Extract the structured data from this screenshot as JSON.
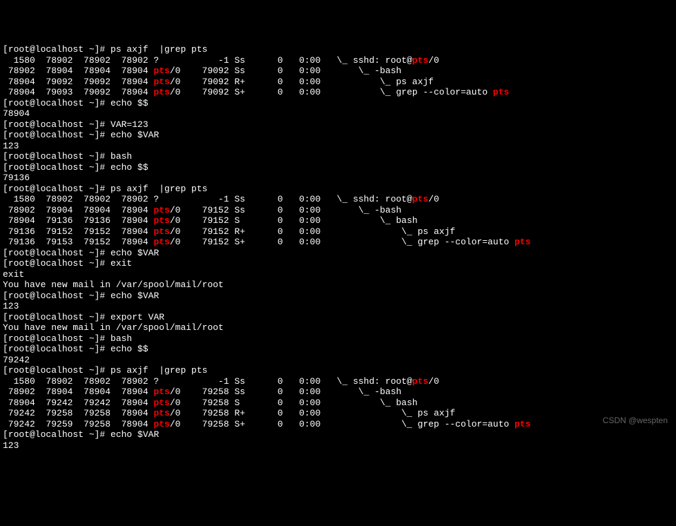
{
  "prompt": "[root@localhost ~]# ",
  "cmd": {
    "ps_grep": "ps axjf  |grep pts",
    "echo_pid": "echo $$",
    "set_var": "VAR=123",
    "echo_var": "echo $VAR",
    "bash": "bash",
    "exit": "exit",
    "export_var": "export VAR"
  },
  "out": {
    "pid_78904": "78904",
    "var_123": "123",
    "pid_79136": "79136",
    "pid_79242": "79242",
    "exit": "exit",
    "blank": "",
    "mail": "You have new mail in /var/spool/mail/root"
  },
  "ps1": {
    "r1": {
      "ppid": "  1580",
      "pid": " 78902",
      "pgid": " 78902",
      "sid": " 78902",
      "tty": "?",
      "tpgid": "   -1",
      "stat": "Ss",
      "uid": "0",
      "time": "0:00",
      "tree": " \\_ sshd: root@",
      "hl": "pts",
      "tail": "/0"
    },
    "r2": {
      "ppid": " 78902",
      "pid": " 78904",
      "pgid": " 78904",
      "sid": " 78904",
      "tty_hl": "pts",
      "tty_tail": "/0",
      "tpgid": "79092",
      "stat": "Ss",
      "uid": "0",
      "time": "0:00",
      "tree": "     \\_ -bash"
    },
    "r3": {
      "ppid": " 78904",
      "pid": " 79092",
      "pgid": " 79092",
      "sid": " 78904",
      "tty_hl": "pts",
      "tty_tail": "/0",
      "tpgid": "79092",
      "stat": "R+",
      "uid": "0",
      "time": "0:00",
      "tree": "         \\_ ps axjf"
    },
    "r4": {
      "ppid": " 78904",
      "pid": " 79093",
      "pgid": " 79092",
      "sid": " 78904",
      "tty_hl": "pts",
      "tty_tail": "/0",
      "tpgid": "79092",
      "stat": "S+",
      "uid": "0",
      "time": "0:00",
      "tree": "         \\_ grep --color=auto ",
      "hl_end": "pts"
    }
  },
  "ps2": {
    "r1": {
      "ppid": "  1580",
      "pid": " 78902",
      "pgid": " 78902",
      "sid": " 78902",
      "tty": "?",
      "tpgid": "   -1",
      "stat": "Ss",
      "uid": "0",
      "time": "0:00",
      "tree": " \\_ sshd: root@",
      "hl": "pts",
      "tail": "/0"
    },
    "r2": {
      "ppid": " 78902",
      "pid": " 78904",
      "pgid": " 78904",
      "sid": " 78904",
      "tty_hl": "pts",
      "tty_tail": "/0",
      "tpgid": "79152",
      "stat": "Ss",
      "uid": "0",
      "time": "0:00",
      "tree": "     \\_ -bash"
    },
    "r3": {
      "ppid": " 78904",
      "pid": " 79136",
      "pgid": " 79136",
      "sid": " 78904",
      "tty_hl": "pts",
      "tty_tail": "/0",
      "tpgid": "79152",
      "stat": "S",
      "uid": "0",
      "time": "0:00",
      "tree": "         \\_ bash"
    },
    "r4": {
      "ppid": " 79136",
      "pid": " 79152",
      "pgid": " 79152",
      "sid": " 78904",
      "tty_hl": "pts",
      "tty_tail": "/0",
      "tpgid": "79152",
      "stat": "R+",
      "uid": "0",
      "time": "0:00",
      "tree": "             \\_ ps axjf"
    },
    "r5": {
      "ppid": " 79136",
      "pid": " 79153",
      "pgid": " 79152",
      "sid": " 78904",
      "tty_hl": "pts",
      "tty_tail": "/0",
      "tpgid": "79152",
      "stat": "S+",
      "uid": "0",
      "time": "0:00",
      "tree": "             \\_ grep --color=auto ",
      "hl_end": "pts"
    }
  },
  "ps3": {
    "r1": {
      "ppid": "  1580",
      "pid": " 78902",
      "pgid": " 78902",
      "sid": " 78902",
      "tty": "?",
      "tpgid": "   -1",
      "stat": "Ss",
      "uid": "0",
      "time": "0:00",
      "tree": " \\_ sshd: root@",
      "hl": "pts",
      "tail": "/0"
    },
    "r2": {
      "ppid": " 78902",
      "pid": " 78904",
      "pgid": " 78904",
      "sid": " 78904",
      "tty_hl": "pts",
      "tty_tail": "/0",
      "tpgid": "79258",
      "stat": "Ss",
      "uid": "0",
      "time": "0:00",
      "tree": "     \\_ -bash"
    },
    "r3": {
      "ppid": " 78904",
      "pid": " 79242",
      "pgid": " 79242",
      "sid": " 78904",
      "tty_hl": "pts",
      "tty_tail": "/0",
      "tpgid": "79258",
      "stat": "S",
      "uid": "0",
      "time": "0:00",
      "tree": "         \\_ bash"
    },
    "r4": {
      "ppid": " 79242",
      "pid": " 79258",
      "pgid": " 79258",
      "sid": " 78904",
      "tty_hl": "pts",
      "tty_tail": "/0",
      "tpgid": "79258",
      "stat": "R+",
      "uid": "0",
      "time": "0:00",
      "tree": "             \\_ ps axjf"
    },
    "r5": {
      "ppid": " 79242",
      "pid": " 79259",
      "pgid": " 79258",
      "sid": " 78904",
      "tty_hl": "pts",
      "tty_tail": "/0",
      "tpgid": "79258",
      "stat": "S+",
      "uid": "0",
      "time": "0:00",
      "tree": "             \\_ grep --color=auto ",
      "hl_end": "pts"
    }
  },
  "watermark": "CSDN @wespten"
}
